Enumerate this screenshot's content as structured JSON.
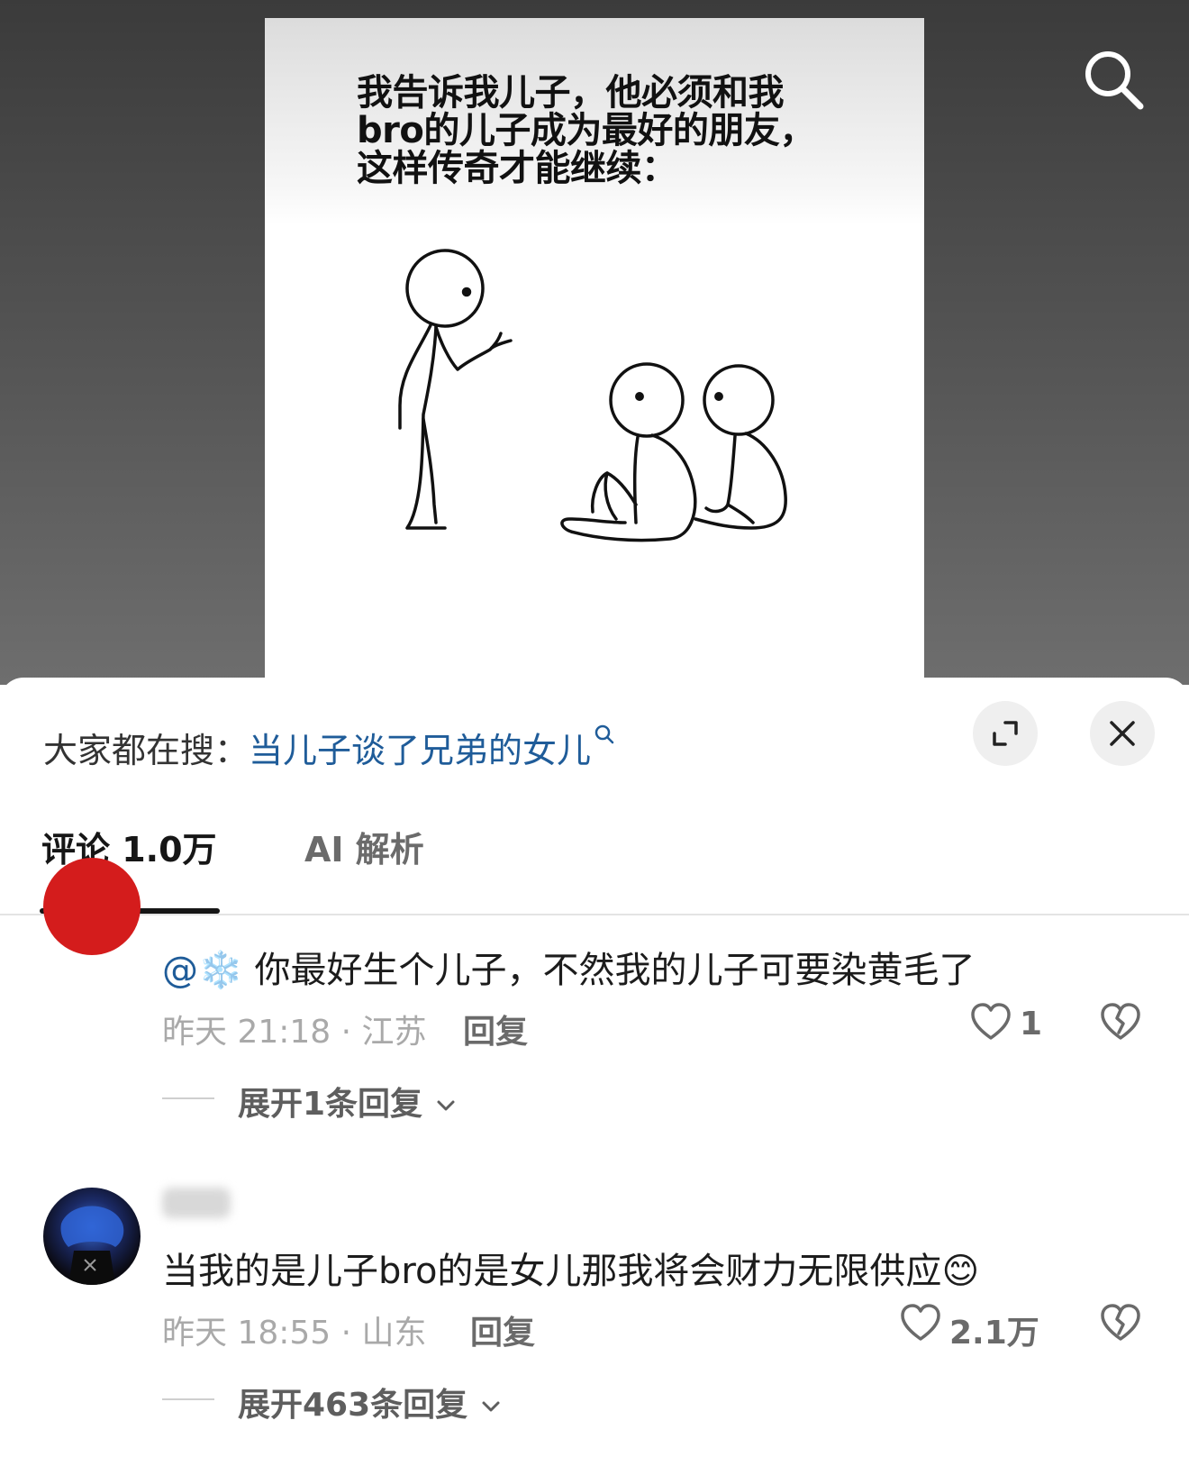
{
  "video": {
    "caption": "我告诉我儿子，他必须和我\nbro的儿子成为最好的朋友，\n这样传奇才能继续："
  },
  "sheet": {
    "hot_search_prefix": "大家都在搜：",
    "hot_search_term": "当儿子谈了兄弟的女儿",
    "tabs": [
      {
        "label": "评论 1.0万",
        "active": true
      },
      {
        "label": "AI 解析",
        "active": false
      }
    ]
  },
  "comments": [
    {
      "mention": "@",
      "mention_emoji": "❄️",
      "text": " 你最好生个儿子，不然我的儿子可要染黄毛了",
      "time_location": "昨天 21:18 · 江苏",
      "reply_label": "回复",
      "likes": "1",
      "expand_label": "展开1条回复"
    },
    {
      "text": "当我的是儿子bro的是女儿那我将会财力无限供应",
      "emoji": "😊",
      "time_location": "昨天 18:55 · 山东",
      "reply_label": "回复",
      "likes": "2.1万",
      "expand_label": "展开463条回复"
    }
  ],
  "icons": {
    "search": "search-icon",
    "expand": "expand-icon",
    "close": "close-icon",
    "like": "heart-icon",
    "dislike": "broken-heart-icon",
    "chevron": "chevron-down-icon"
  }
}
